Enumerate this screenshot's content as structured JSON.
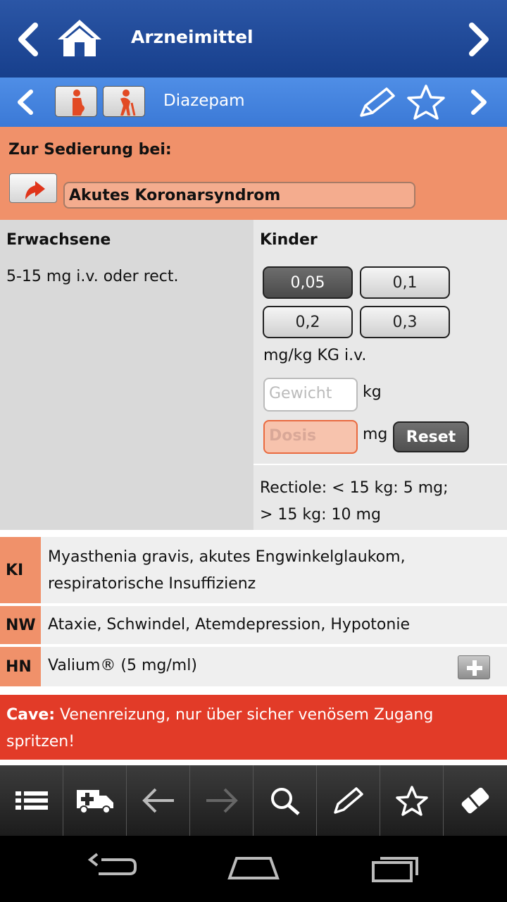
{
  "header": {
    "title": "Arzneimittel"
  },
  "subheader": {
    "drug": "Diazepam"
  },
  "indication": {
    "label": "Zur Sedierung bei:",
    "link": "Akutes Koronarsyndrom"
  },
  "adult": {
    "heading": "Erwachsene",
    "dose": "5-15 mg i.v. oder rect."
  },
  "children": {
    "heading": "Kinder",
    "options": [
      "0,05",
      "0,1",
      "0,2",
      "0,3"
    ],
    "selected": "0,05",
    "unit": "mg/kg KG i.v.",
    "weight_placeholder": "Gewicht",
    "weight_unit": "kg",
    "dose_placeholder": "Dosis",
    "dose_unit": "mg",
    "reset_label": "Reset",
    "note_line1": "Rectiole: < 15 kg: 5 mg;",
    "note_line2": "> 15 kg: 10 mg"
  },
  "info": {
    "ki_label": "KI",
    "ki_line1": "Myasthenia gravis, akutes Engwinkelglaukom,",
    "ki_line2": "respiratorische Insuffizienz",
    "nw_label": "NW",
    "nw_text": "Ataxie, Schwindel, Atemdepression, Hypotonie",
    "hn_label": "HN",
    "hn_text": "Valium® (5 mg/ml)"
  },
  "cave": {
    "label": "Cave:",
    "text": " Venenreizung, nur über sicher venösem Zugang spritzen!"
  },
  "toolbar_icons": [
    "list-icon",
    "ambulance-icon",
    "back-arrow-icon",
    "forward-arrow-icon",
    "search-icon",
    "pencil-icon",
    "star-icon",
    "eraser-icon"
  ],
  "colors": {
    "header": "#1f4a9a",
    "subheader": "#4a88e2",
    "accent_orange": "#f0916a",
    "cave_red": "#e23b28"
  }
}
